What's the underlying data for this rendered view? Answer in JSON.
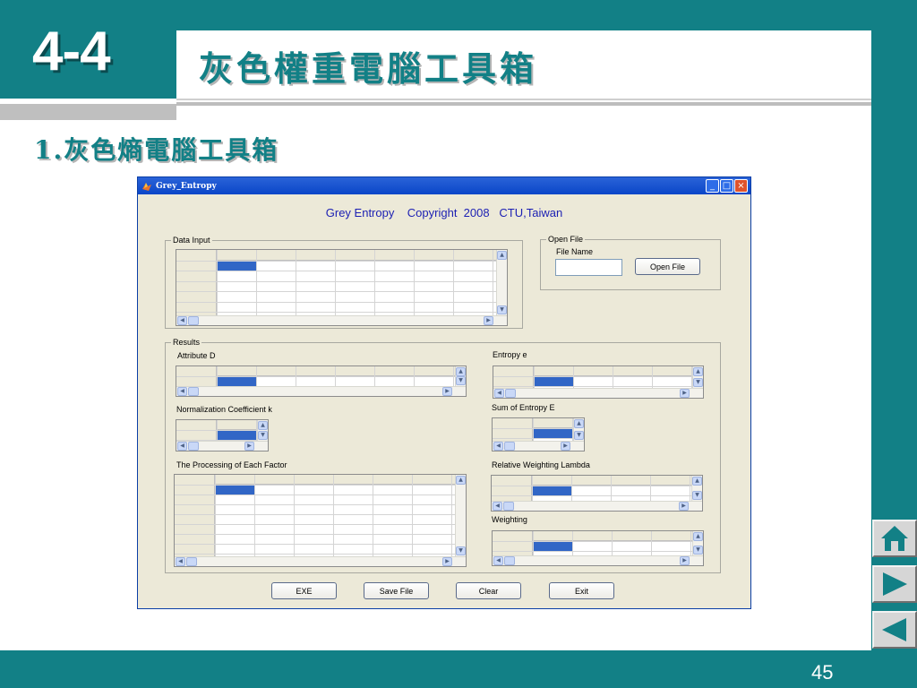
{
  "slide": {
    "section_number": "4-4",
    "title": "灰色權重電腦工具箱",
    "subtitle": "1.灰色熵電腦工具箱",
    "page_number": "45"
  },
  "window": {
    "title": "Grey_Entropy",
    "header": "Grey Entropy    Copyright  2008   CTU,Taiwan"
  },
  "data_input": {
    "label": "Data Input"
  },
  "open_file": {
    "label": "Open File",
    "file_name_label": "File Name",
    "file_name_value": "",
    "button_label": "Open File"
  },
  "results": {
    "label": "Results",
    "attribute_d": "Attribute D",
    "entropy_e": "Entropy e",
    "normalization_k": "Normalization Coefficient k",
    "sum_entropy_e": "Sum of Entropy E",
    "processing_factor": "The Processing of Each Factor",
    "relative_lambda": "Relative Weighting Lambda",
    "weighting": "Weighting"
  },
  "buttons": {
    "exe": "EXE",
    "save_file": "Save File",
    "clear": "Clear",
    "exit": "Exit"
  },
  "icons": {
    "home": "home-icon",
    "next": "play-right-icon",
    "prev": "play-left-icon",
    "app_logo": "matlab-logo-icon"
  },
  "colors": {
    "teal": "#128086",
    "selection": "#3166c6",
    "header_text": "#1b1fb3"
  }
}
